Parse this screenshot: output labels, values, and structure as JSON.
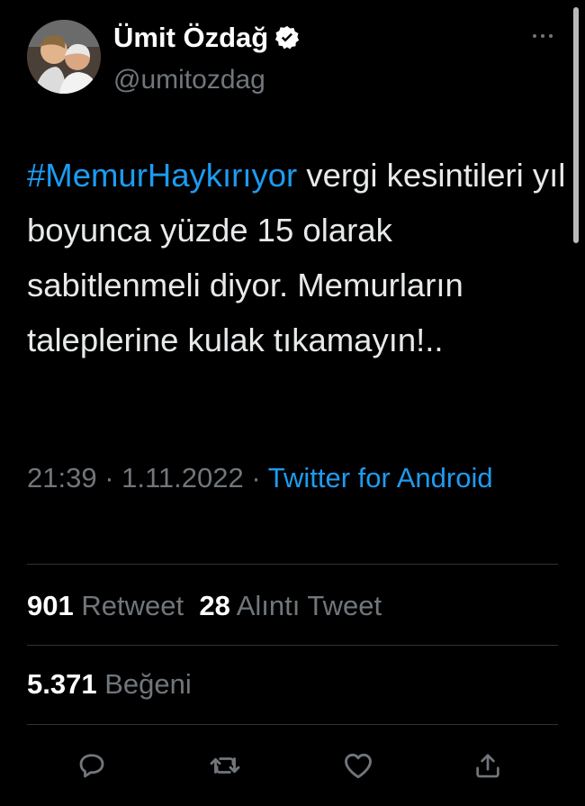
{
  "author": {
    "name": "Ümit Özdağ",
    "handle": "@umitozdag",
    "verified": true,
    "avatar_icon": "profile-photo"
  },
  "tweet": {
    "hashtag": "#MemurHaykırıyor",
    "text": " vergi kesintileri yıl boyunca yüzde 15 olarak sabitlenmeli diyor. Memurların taleplerine kulak tıkamayın!.."
  },
  "meta": {
    "time": "21:39",
    "separator": " · ",
    "date": "1.11.2022",
    "separator2": " · ",
    "source": "Twitter for Android"
  },
  "stats": {
    "retweets_count": "901",
    "retweets_label": "Retweet",
    "quotes_count": "28",
    "quotes_label": "Alıntı Tweet",
    "likes_count": "5.371",
    "likes_label": "Beğeni"
  },
  "actions": {
    "reply": "reply-icon",
    "retweet": "retweet-icon",
    "like": "heart-icon",
    "share": "share-icon"
  },
  "colors": {
    "background": "#000000",
    "text": "#e7e9ea",
    "secondary": "#71767b",
    "accent": "#1d9bf0",
    "divider": "#2f3336"
  }
}
